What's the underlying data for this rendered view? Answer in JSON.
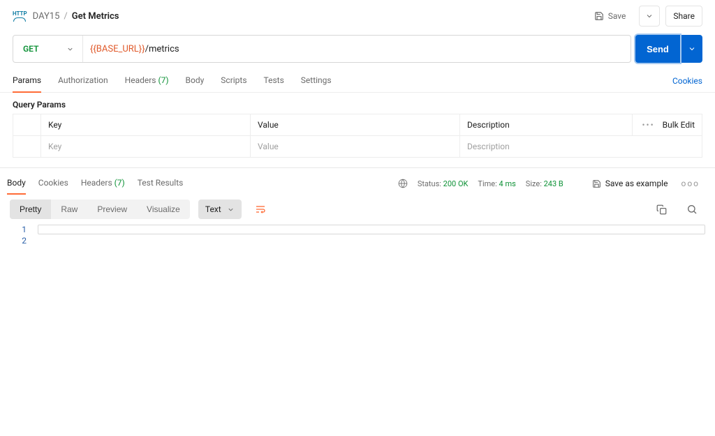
{
  "breadcrumb": {
    "folder": "DAY15",
    "title": "Get Metrics"
  },
  "topbar": {
    "save": "Save",
    "share": "Share"
  },
  "request": {
    "method": "GET",
    "url_var": "{{BASE_URL}}",
    "url_path": "/metrics",
    "send": "Send"
  },
  "req_tabs": {
    "params": "Params",
    "authorization": "Authorization",
    "headers": "Headers",
    "headers_count": "(7)",
    "body": "Body",
    "scripts": "Scripts",
    "tests": "Tests",
    "settings": "Settings",
    "cookies": "Cookies"
  },
  "query_params": {
    "title": "Query Params",
    "col_key": "Key",
    "col_value": "Value",
    "col_desc": "Description",
    "bulk_edit": "Bulk Edit",
    "ph_key": "Key",
    "ph_value": "Value",
    "ph_desc": "Description"
  },
  "res_tabs": {
    "body": "Body",
    "cookies": "Cookies",
    "headers": "Headers",
    "headers_count": "(7)",
    "test_results": "Test Results"
  },
  "status": {
    "status_label": "Status:",
    "status_value": "200 OK",
    "time_label": "Time:",
    "time_value": "4 ms",
    "size_label": "Size:",
    "size_value": "243 B",
    "save_example": "Save as example"
  },
  "body_toolbar": {
    "pretty": "Pretty",
    "raw": "Raw",
    "preview": "Preview",
    "visualize": "Visualize",
    "lang": "Text"
  },
  "editor": {
    "line1": "1",
    "line2": "2"
  }
}
